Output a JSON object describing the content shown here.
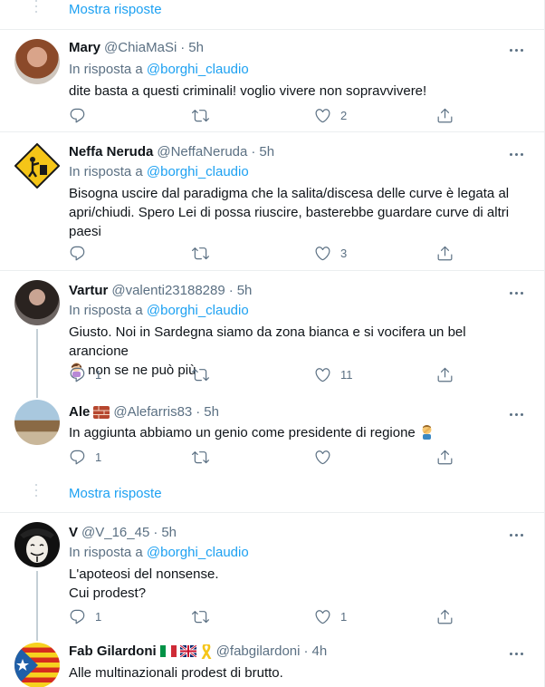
{
  "show_more_top": "Mostra risposte",
  "show_more_mid": "Mostra risposte",
  "reply_prefix": "In risposta a",
  "tweets": [
    {
      "name": "Mary",
      "handle": "@ChiaMaSi",
      "sep": "·",
      "time": "5h",
      "reply_to": "@borghi_claudio",
      "text": "dite basta a questi criminali! voglio vivere non sopravvivere!",
      "replies": "",
      "likes": "2"
    },
    {
      "name": "Neffa Neruda",
      "handle": "@NeffaNeruda",
      "sep": "·",
      "time": "5h",
      "reply_to": "@borghi_claudio",
      "text": "Bisogna uscire dal paradigma che la salita/discesa delle curve è legata al apri/chiudi. Spero Lei di possa riuscire, basterebbe guardare curve di altri paesi",
      "replies": "",
      "likes": "3"
    },
    {
      "name": "Vartur",
      "handle": "@valenti23188289",
      "sep": "·",
      "time": "5h",
      "reply_to": "@borghi_claudio",
      "text": "Giusto. Noi in Sardegna siamo da zona bianca e si vocifera un bel arancione",
      "text2": "non se ne può più",
      "replies": "1",
      "likes": "11"
    },
    {
      "name": "Ale",
      "handle": "@Alefarris83",
      "sep": "·",
      "time": "5h",
      "text": "In aggiunta abbiamo un genio come presidente di regione",
      "replies": "1",
      "likes": ""
    },
    {
      "name": "V",
      "handle": "@V_16_45",
      "sep": "·",
      "time": "5h",
      "reply_to": "@borghi_claudio",
      "text": "L'apoteosi del nonsense.",
      "text2": "Cui prodest?",
      "replies": "1",
      "likes": "1"
    },
    {
      "name": "Fab Gilardoni",
      "handle": "@fabgilardoni",
      "sep": "·",
      "time": "4h",
      "text": "Alle multinazionali prodest di brutto.",
      "replies": "",
      "likes": ""
    }
  ],
  "icons": {
    "reply": "reply-icon",
    "retweet": "retweet-icon",
    "like": "heart-icon",
    "share": "share-icon",
    "more": "more-icon"
  },
  "colors": {
    "link": "#1da1f2",
    "muted": "#5b7083",
    "text": "#0f1419",
    "border": "#ebeef0"
  }
}
